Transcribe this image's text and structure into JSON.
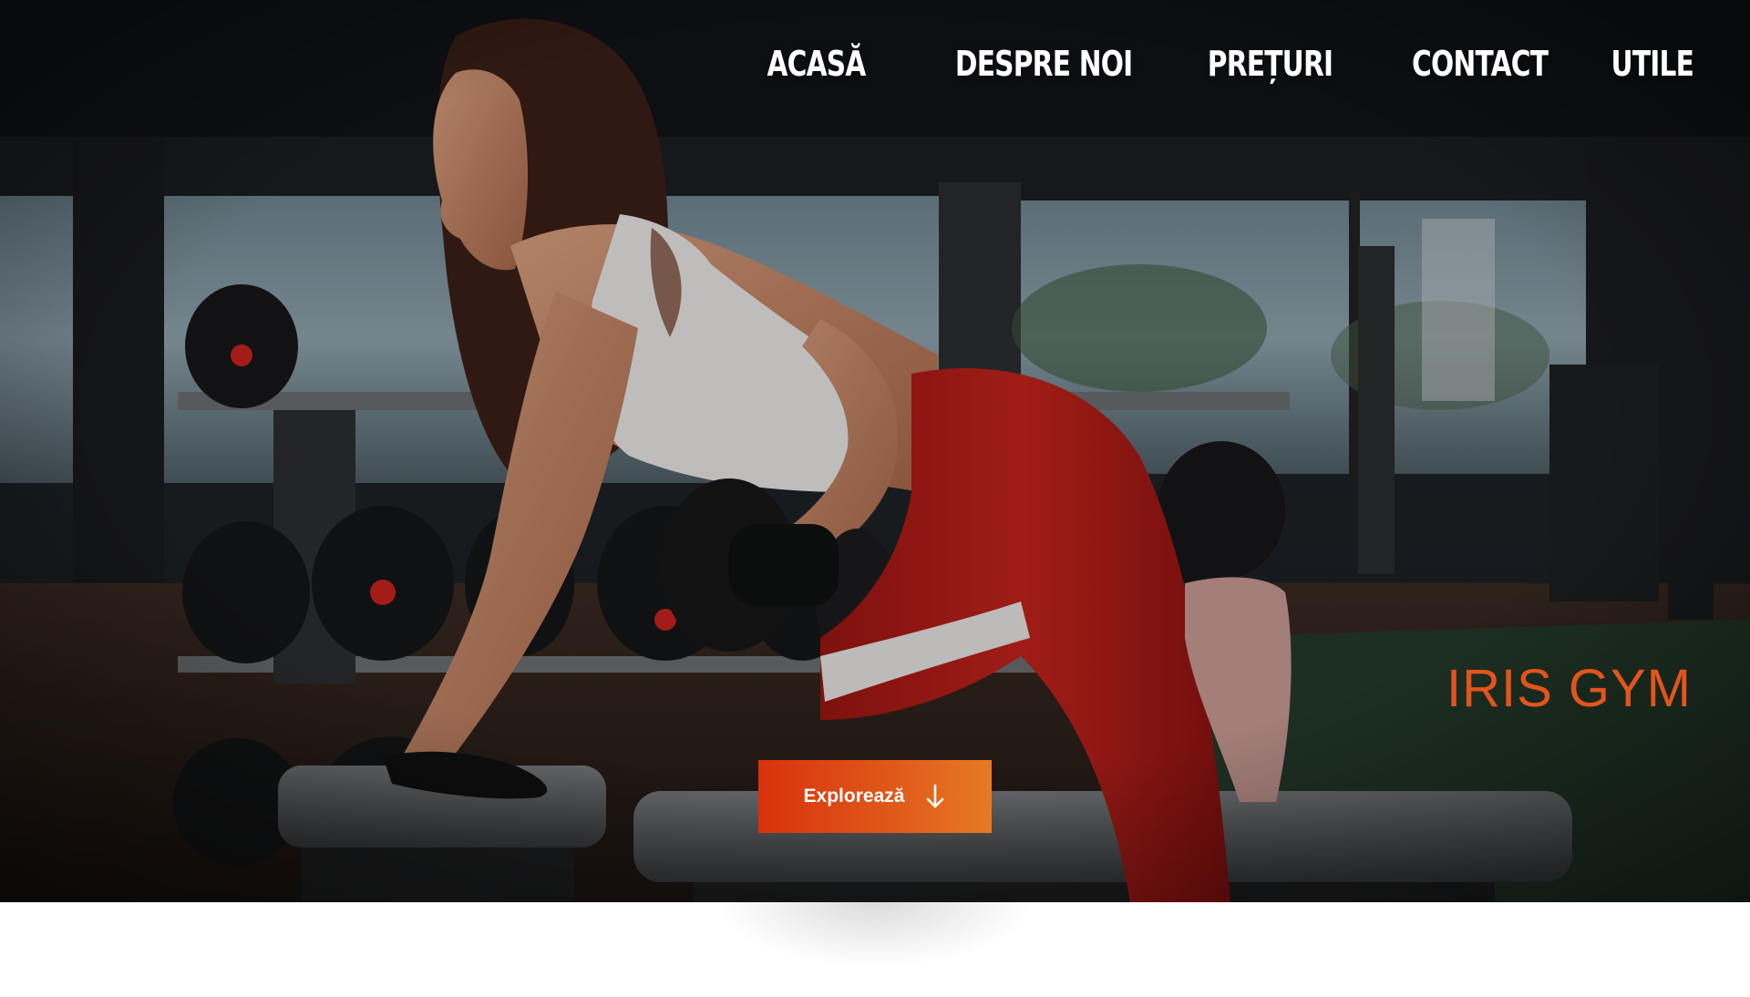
{
  "nav": {
    "items": [
      {
        "label": "ACASĂ"
      },
      {
        "label": "DESPRE NOI"
      },
      {
        "label": "PREȚURI"
      },
      {
        "label": "CONTACT"
      },
      {
        "label": "UTILE"
      }
    ]
  },
  "hero": {
    "brand": "IRIS GYM",
    "cta_label": "Explorează",
    "cta_icon": "arrow-down-icon"
  },
  "colors": {
    "accent": "#e2541e",
    "cta_start": "#d8320c",
    "cta_end": "#e67a22",
    "nav_text": "#ffffff"
  }
}
